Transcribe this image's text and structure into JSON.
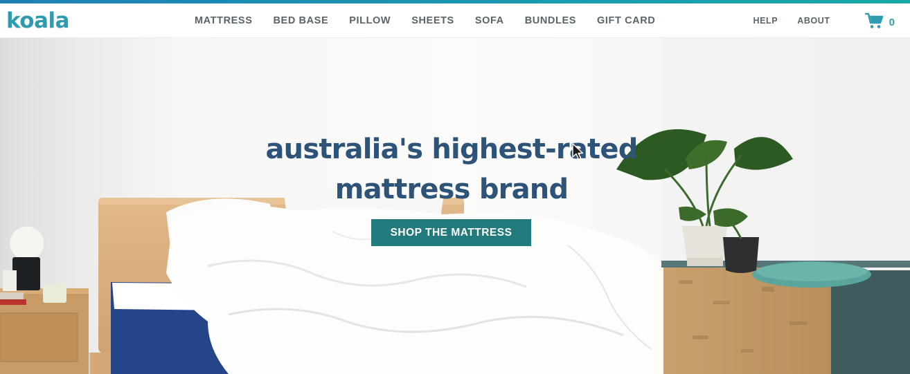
{
  "brand": {
    "logo_text": "koala"
  },
  "nav": {
    "items": [
      "MATTRESS",
      "BED BASE",
      "PILLOW",
      "SHEETS",
      "SOFA",
      "BUNDLES",
      "GIFT CARD"
    ]
  },
  "utility_nav": {
    "help": "HELP",
    "about": "ABOUT"
  },
  "cart": {
    "icon": "shopping-cart-icon",
    "count": "0"
  },
  "hero": {
    "headline_line1": "australia's highest-rated",
    "headline_line2": "mattress brand",
    "cta_label": "SHOP THE MATTRESS"
  },
  "colors": {
    "brand_teal": "#2f9bb0",
    "nav_text": "#5a6468",
    "headline": "#2d5378",
    "cta_bg": "#237a7c",
    "mattress_blue": "#24458a"
  }
}
